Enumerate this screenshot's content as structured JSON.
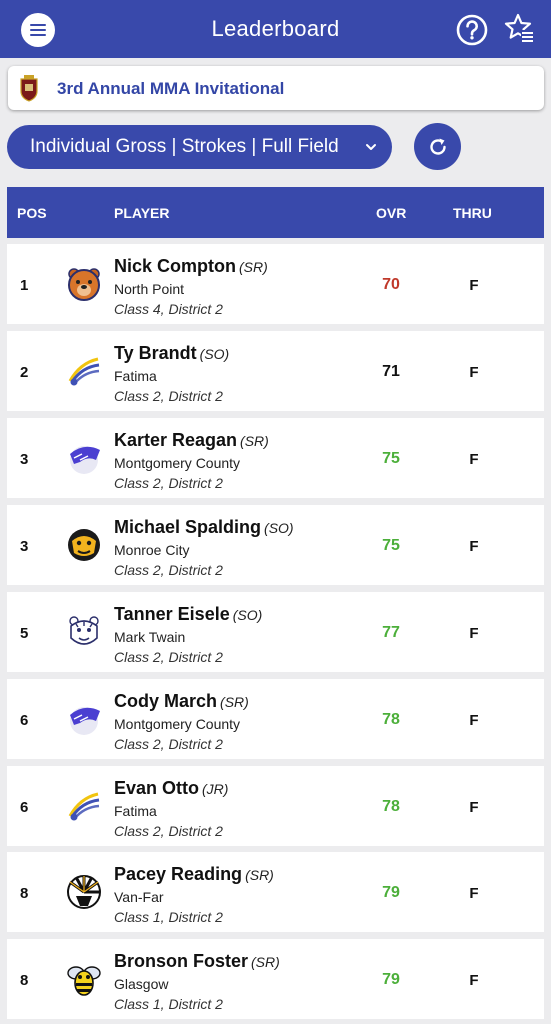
{
  "header": {
    "title": "Leaderboard",
    "menu_icon": "hamburger-icon",
    "help_icon": "question-circle-icon",
    "favorites_icon": "star-list-icon"
  },
  "event": {
    "name": "3rd Annual MMA Invitational",
    "logo_icon": "crest-logo"
  },
  "filter": {
    "label": "Individual Gross | Strokes | Full Field",
    "refresh_icon": "refresh-icon"
  },
  "table": {
    "columns": {
      "pos": "POS",
      "player": "PLAYER",
      "ovr": "OVR",
      "thru": "THRU"
    },
    "rows": [
      {
        "pos": "1",
        "name": "Nick Compton",
        "year": "(SR)",
        "school": "North Point",
        "class": "Class 4, District 2",
        "ovr": "70",
        "thru": "F",
        "ovr_color": "#c0392b",
        "logo": "bear-mascot-icon"
      },
      {
        "pos": "2",
        "name": "Ty Brandt",
        "year": "(SO)",
        "school": "Fatima",
        "class": "Class 2, District 2",
        "ovr": "71",
        "thru": "F",
        "ovr_color": "#111111",
        "logo": "comet-mascot-icon"
      },
      {
        "pos": "3",
        "name": "Karter Reagan",
        "year": "(SR)",
        "school": "Montgomery County",
        "class": "Class 2, District 2",
        "ovr": "75",
        "thru": "F",
        "ovr_color": "#4caf3a",
        "logo": "wildcat-mascot-icon"
      },
      {
        "pos": "3",
        "name": "Michael Spalding",
        "year": "(SO)",
        "school": "Monroe City",
        "class": "Class 2, District 2",
        "ovr": "75",
        "thru": "F",
        "ovr_color": "#4caf3a",
        "logo": "panther-mascot-icon"
      },
      {
        "pos": "5",
        "name": "Tanner Eisele",
        "year": "(SO)",
        "school": "Mark Twain",
        "class": "Class 2, District 2",
        "ovr": "77",
        "thru": "F",
        "ovr_color": "#4caf3a",
        "logo": "tiger-mascot-icon"
      },
      {
        "pos": "6",
        "name": "Cody March",
        "year": "(SR)",
        "school": "Montgomery County",
        "class": "Class 2, District 2",
        "ovr": "78",
        "thru": "F",
        "ovr_color": "#4caf3a",
        "logo": "wildcat-mascot-icon"
      },
      {
        "pos": "6",
        "name": "Evan Otto",
        "year": "(JR)",
        "school": "Fatima",
        "class": "Class 2, District 2",
        "ovr": "78",
        "thru": "F",
        "ovr_color": "#4caf3a",
        "logo": "comet-mascot-icon"
      },
      {
        "pos": "8",
        "name": "Pacey Reading",
        "year": "(SR)",
        "school": "Van-Far",
        "class": "Class 1, District 2",
        "ovr": "79",
        "thru": "F",
        "ovr_color": "#4caf3a",
        "logo": "indian-mascot-icon"
      },
      {
        "pos": "8",
        "name": "Bronson Foster",
        "year": "(SR)",
        "school": "Glasgow",
        "class": "Class 1, District 2",
        "ovr": "79",
        "thru": "F",
        "ovr_color": "#4caf3a",
        "logo": "hornet-mascot-icon"
      }
    ]
  }
}
